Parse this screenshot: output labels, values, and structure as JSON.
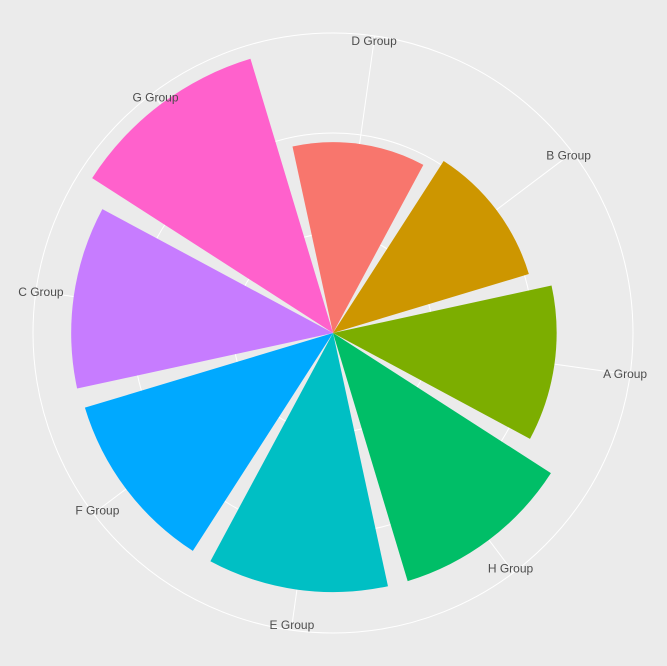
{
  "chart_data": {
    "type": "bar",
    "coord": "polar",
    "categories": [
      "D Group",
      "B Group",
      "A Group",
      "H Group",
      "E Group",
      "F Group",
      "C Group",
      "G Group"
    ],
    "values": [
      7.0,
      7.5,
      8.2,
      9.5,
      9.5,
      9.5,
      9.6,
      10.5
    ],
    "colors": [
      "#F8766D",
      "#CD9600",
      "#7CAE00",
      "#00BE67",
      "#00BFC4",
      "#00A9FF",
      "#C77CFF",
      "#FF61CC"
    ],
    "rlim": [
      0,
      11
    ],
    "grid": true,
    "legend": "none"
  }
}
